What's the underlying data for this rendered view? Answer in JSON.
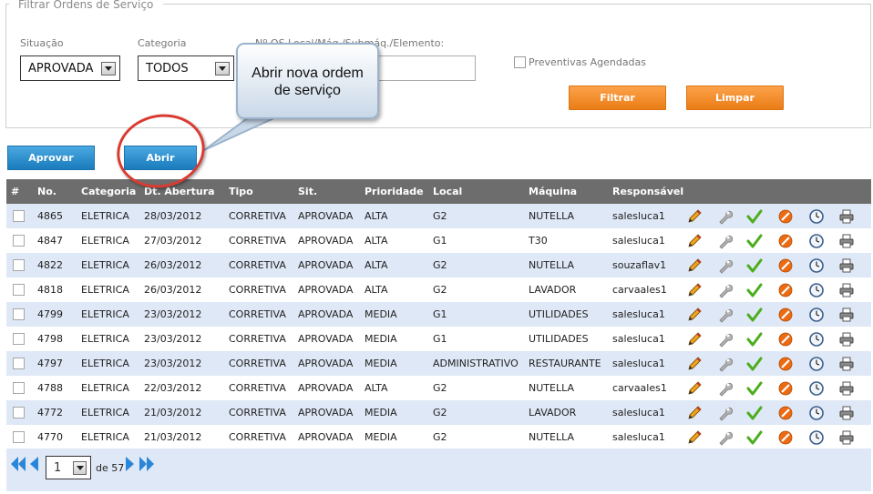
{
  "filter": {
    "legend": "Filtrar Ordens de Serviço",
    "situacao_label": "Situação",
    "situacao_value": "APROVADA",
    "categoria_label": "Categoria",
    "categoria_value": "TODOS",
    "local_label": "Nº OS    Local/Máq./Submáq./Elemento:",
    "local_value": "",
    "preventivas_label": "Preventivas Agendadas",
    "filtrar_label": "Filtrar",
    "limpar_label": "Limpar"
  },
  "actions": {
    "aprovar_label": "Aprovar",
    "abrir_label": "Abrir"
  },
  "callout": {
    "line1": "Abrir nova ordem",
    "line2": "de serviço"
  },
  "table": {
    "headers": [
      "#",
      "No.",
      "Categoria",
      "Dt. Abertura",
      "Tipo",
      "Sit.",
      "Prioridade",
      "Local",
      "Máquina",
      "Responsável"
    ],
    "rows": [
      [
        "4865",
        "ELETRICA",
        "28/03/2012",
        "CORRETIVA",
        "APROVADA",
        "ALTA",
        "G2",
        "NUTELLA",
        "salesluca1"
      ],
      [
        "4847",
        "ELETRICA",
        "27/03/2012",
        "CORRETIVA",
        "APROVADA",
        "ALTA",
        "G1",
        "T30",
        "salesluca1"
      ],
      [
        "4822",
        "ELETRICA",
        "26/03/2012",
        "CORRETIVA",
        "APROVADA",
        "ALTA",
        "G2",
        "NUTELLA",
        "souzaflav1"
      ],
      [
        "4818",
        "ELETRICA",
        "26/03/2012",
        "CORRETIVA",
        "APROVADA",
        "ALTA",
        "G2",
        "LAVADOR",
        "carvaales1"
      ],
      [
        "4799",
        "ELETRICA",
        "23/03/2012",
        "CORRETIVA",
        "APROVADA",
        "MEDIA",
        "G1",
        "UTILIDADES",
        "salesluca1"
      ],
      [
        "4798",
        "ELETRICA",
        "23/03/2012",
        "CORRETIVA",
        "APROVADA",
        "MEDIA",
        "G1",
        "UTILIDADES",
        "salesluca1"
      ],
      [
        "4797",
        "ELETRICA",
        "23/03/2012",
        "CORRETIVA",
        "APROVADA",
        "MEDIA",
        "ADMINISTRATIVO",
        "RESTAURANTE",
        "salesluca1"
      ],
      [
        "4788",
        "ELETRICA",
        "22/03/2012",
        "CORRETIVA",
        "APROVADA",
        "ALTA",
        "G2",
        "NUTELLA",
        "carvaales1"
      ],
      [
        "4772",
        "ELETRICA",
        "21/03/2012",
        "CORRETIVA",
        "APROVADA",
        "MEDIA",
        "G2",
        "LAVADOR",
        "salesluca1"
      ],
      [
        "4770",
        "ELETRICA",
        "21/03/2012",
        "CORRETIVA",
        "APROVADA",
        "MEDIA",
        "G2",
        "NUTELLA",
        "salesluca1"
      ]
    ],
    "row_icons": [
      "pencil-icon",
      "wrench-icon",
      "check-icon",
      "cancel-icon",
      "clock-icon",
      "printer-icon"
    ]
  },
  "pager": {
    "page": "1",
    "of_label": "de 57"
  },
  "colors": {
    "orange": "#f28a22",
    "blue": "#1f84c7",
    "header_gray": "#6d6d6d",
    "row_alt": "#dfe8f6"
  }
}
